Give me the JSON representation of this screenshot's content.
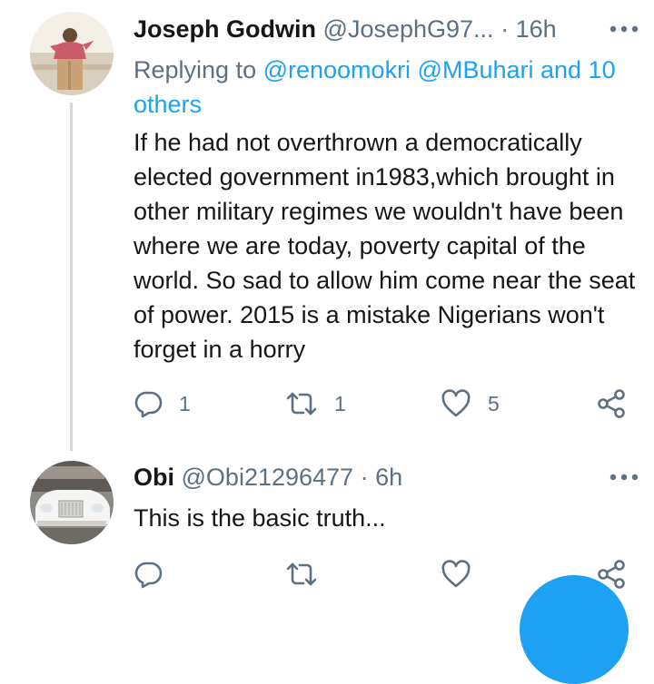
{
  "tweet1": {
    "name": "Joseph Godwin",
    "handle": "@JosephG97...",
    "separator": "·",
    "time": "16h",
    "replying_prefix": "Replying to ",
    "replying_links": "@renoomokri @MBuhari and 10 others",
    "text": "If he had not overthrown a democratically elected government in1983,which brought in other military regimes we wouldn't have been where we are today, poverty capital of the world. So sad to allow him come near the seat of power. 2015 is a mistake Nigerians won't forget in a horry",
    "reply_count": "1",
    "retweet_count": "1",
    "like_count": "5"
  },
  "tweet2": {
    "name": "Obi",
    "handle": "@Obi21296477",
    "separator": "·",
    "time": "6h",
    "text": "This is the basic truth..."
  },
  "colors": {
    "link": "#1da1f2",
    "muted": "#5b7083",
    "text": "#14171a",
    "thread_line": "#cfd9de"
  },
  "icons": [
    "more-icon",
    "reply-icon",
    "retweet-icon",
    "like-icon",
    "share-icon"
  ]
}
